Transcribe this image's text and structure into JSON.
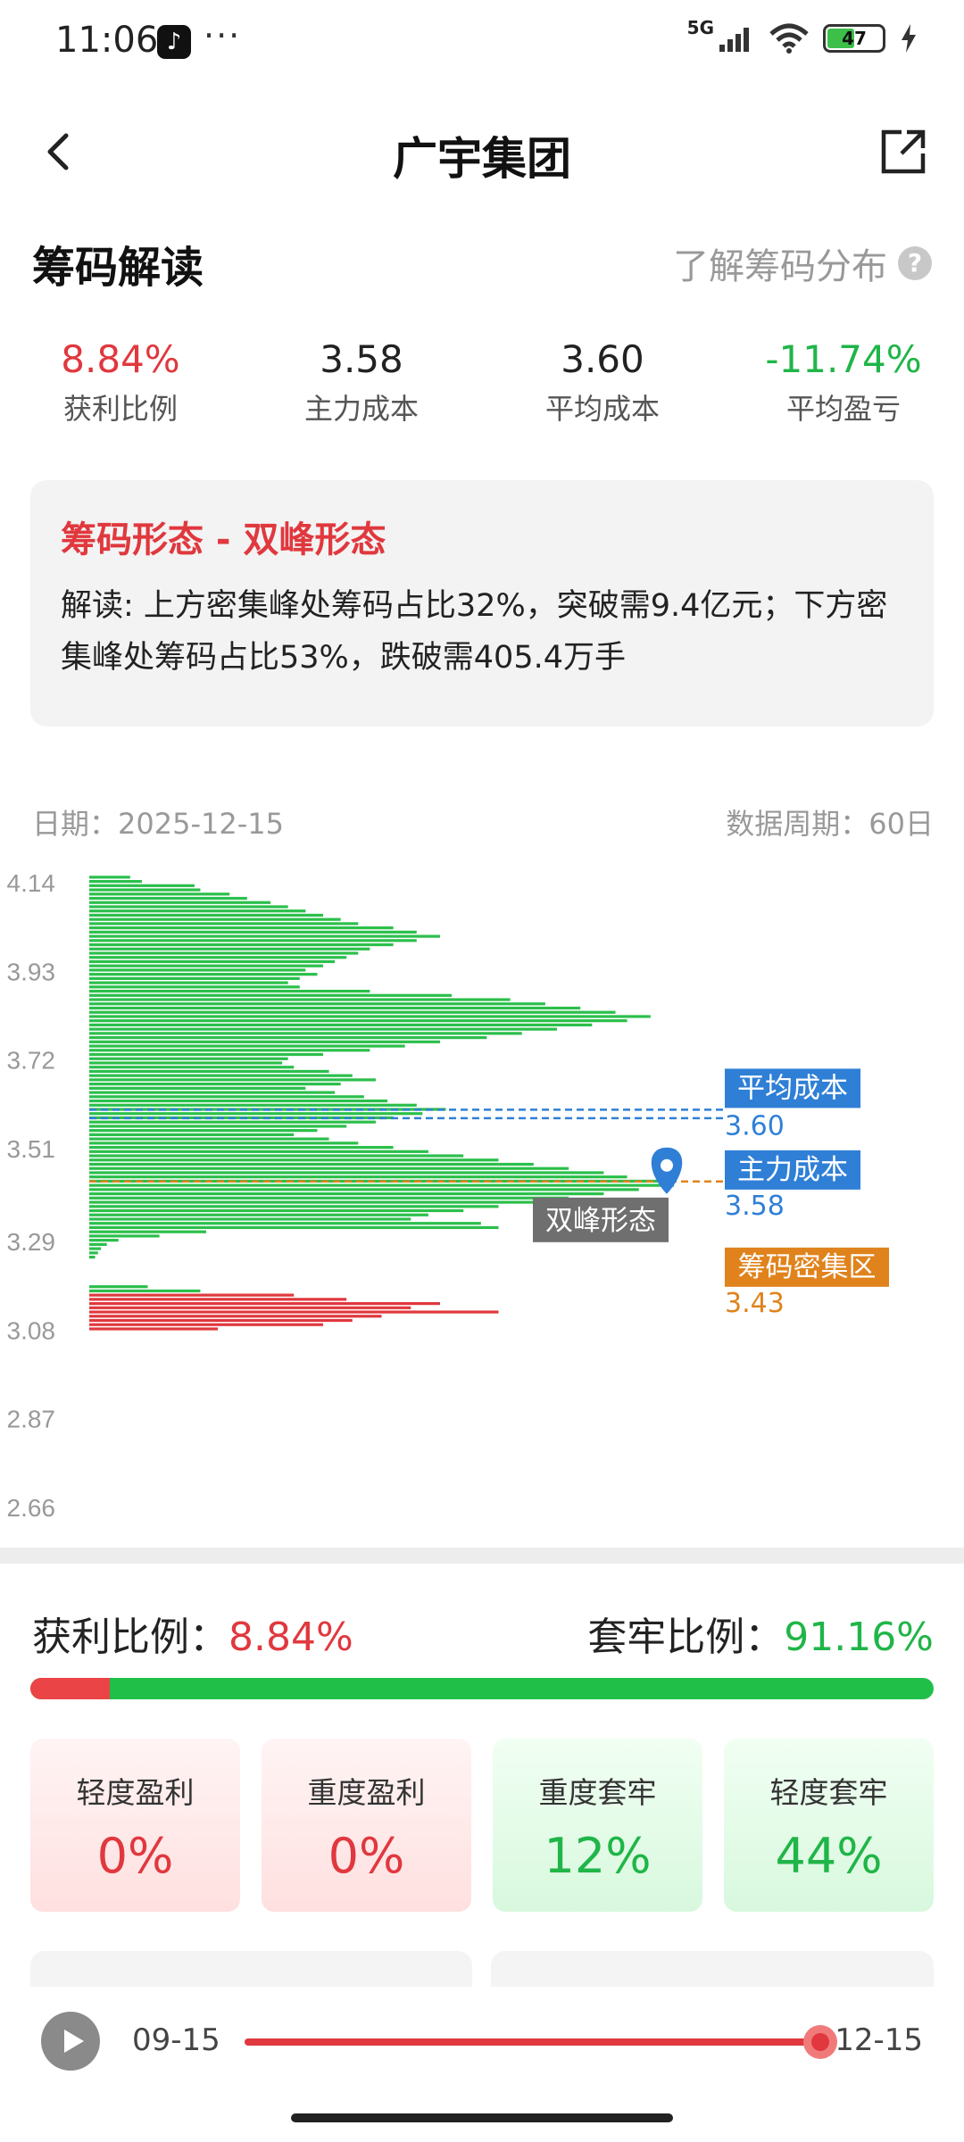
{
  "status_bar": {
    "time": "11:06",
    "app_badge": "♪",
    "dots": "···",
    "network": "5G",
    "battery": "47"
  },
  "header": {
    "title": "广宇集团"
  },
  "section": {
    "title": "筹码解读",
    "learn_link": "了解筹码分布",
    "help": "?"
  },
  "stats": [
    {
      "value": "8.84%",
      "label": "获利比例",
      "tone": "red"
    },
    {
      "value": "3.58",
      "label": "主力成本",
      "tone": "normal"
    },
    {
      "value": "3.60",
      "label": "平均成本",
      "tone": "normal"
    },
    {
      "value": "-11.74%",
      "label": "平均盈亏",
      "tone": "green"
    }
  ],
  "form_card": {
    "title": "筹码形态 - 双峰形态",
    "description": "解读: 上方密集峰处筹码占比32%，突破需9.4亿元；下方密集峰处筹码占比53%，跌破需405.4万手"
  },
  "chart_meta": {
    "date": "日期：2025-12-15",
    "period": "数据周期：60日"
  },
  "chart_data": {
    "type": "bar",
    "orientation": "horizontal",
    "y_ticks": [
      "4.14",
      "3.93",
      "3.72",
      "3.51",
      "3.29",
      "3.08",
      "2.87",
      "2.66"
    ],
    "ylim": [
      2.66,
      4.14
    ],
    "series": [
      {
        "name": "获利",
        "color": "#e0383e"
      },
      {
        "name": "套牢",
        "color": "#2bbf4b"
      }
    ],
    "bars": [
      [
        4.15,
        0.07,
        "g"
      ],
      [
        4.14,
        0.09,
        "g"
      ],
      [
        4.13,
        0.18,
        "g"
      ],
      [
        4.12,
        0.19,
        "g"
      ],
      [
        4.11,
        0.24,
        "g"
      ],
      [
        4.1,
        0.27,
        "g"
      ],
      [
        4.09,
        0.31,
        "g"
      ],
      [
        4.08,
        0.34,
        "g"
      ],
      [
        4.07,
        0.37,
        "g"
      ],
      [
        4.06,
        0.4,
        "g"
      ],
      [
        4.05,
        0.43,
        "g"
      ],
      [
        4.04,
        0.46,
        "g"
      ],
      [
        4.03,
        0.52,
        "g"
      ],
      [
        4.02,
        0.56,
        "g"
      ],
      [
        4.01,
        0.6,
        "g"
      ],
      [
        4.0,
        0.56,
        "g"
      ],
      [
        3.99,
        0.52,
        "g"
      ],
      [
        3.98,
        0.48,
        "g"
      ],
      [
        3.97,
        0.46,
        "g"
      ],
      [
        3.96,
        0.44,
        "g"
      ],
      [
        3.95,
        0.42,
        "g"
      ],
      [
        3.94,
        0.4,
        "g"
      ],
      [
        3.93,
        0.37,
        "g"
      ],
      [
        3.92,
        0.39,
        "g"
      ],
      [
        3.91,
        0.36,
        "g"
      ],
      [
        3.9,
        0.34,
        "g"
      ],
      [
        3.89,
        0.36,
        "g"
      ],
      [
        3.88,
        0.48,
        "g"
      ],
      [
        3.87,
        0.62,
        "g"
      ],
      [
        3.86,
        0.72,
        "g"
      ],
      [
        3.85,
        0.78,
        "g"
      ],
      [
        3.84,
        0.84,
        "g"
      ],
      [
        3.83,
        0.9,
        "g"
      ],
      [
        3.82,
        0.96,
        "g"
      ],
      [
        3.81,
        0.92,
        "g"
      ],
      [
        3.8,
        0.86,
        "g"
      ],
      [
        3.79,
        0.8,
        "g"
      ],
      [
        3.78,
        0.74,
        "g"
      ],
      [
        3.77,
        0.68,
        "g"
      ],
      [
        3.76,
        0.6,
        "g"
      ],
      [
        3.75,
        0.54,
        "g"
      ],
      [
        3.74,
        0.48,
        "g"
      ],
      [
        3.73,
        0.4,
        "g"
      ],
      [
        3.72,
        0.34,
        "g"
      ],
      [
        3.71,
        0.33,
        "g"
      ],
      [
        3.7,
        0.35,
        "g"
      ],
      [
        3.69,
        0.41,
        "g"
      ],
      [
        3.68,
        0.45,
        "g"
      ],
      [
        3.67,
        0.49,
        "g"
      ],
      [
        3.66,
        0.43,
        "g"
      ],
      [
        3.65,
        0.37,
        "g"
      ],
      [
        3.64,
        0.42,
        "g"
      ],
      [
        3.63,
        0.47,
        "g"
      ],
      [
        3.62,
        0.51,
        "g"
      ],
      [
        3.61,
        0.56,
        "g"
      ],
      [
        3.6,
        0.61,
        "g"
      ],
      [
        3.59,
        0.57,
        "g"
      ],
      [
        3.58,
        0.52,
        "g"
      ],
      [
        3.57,
        0.49,
        "g"
      ],
      [
        3.56,
        0.44,
        "g"
      ],
      [
        3.55,
        0.39,
        "g"
      ],
      [
        3.54,
        0.35,
        "g"
      ],
      [
        3.53,
        0.41,
        "g"
      ],
      [
        3.52,
        0.46,
        "g"
      ],
      [
        3.51,
        0.52,
        "g"
      ],
      [
        3.5,
        0.58,
        "g"
      ],
      [
        3.49,
        0.64,
        "g"
      ],
      [
        3.48,
        0.7,
        "g"
      ],
      [
        3.47,
        0.76,
        "g"
      ],
      [
        3.46,
        0.82,
        "g"
      ],
      [
        3.45,
        0.88,
        "g"
      ],
      [
        3.44,
        0.92,
        "g"
      ],
      [
        3.43,
        0.98,
        "g"
      ],
      [
        3.42,
        1.0,
        "g"
      ],
      [
        3.41,
        0.94,
        "g"
      ],
      [
        3.4,
        0.88,
        "g"
      ],
      [
        3.39,
        0.82,
        "g"
      ],
      [
        3.38,
        0.76,
        "g"
      ],
      [
        3.37,
        0.7,
        "g"
      ],
      [
        3.36,
        0.64,
        "g"
      ],
      [
        3.35,
        0.58,
        "g"
      ],
      [
        3.34,
        0.55,
        "g"
      ],
      [
        3.33,
        0.67,
        "g"
      ],
      [
        3.32,
        0.7,
        "g"
      ],
      [
        3.31,
        0.2,
        "g"
      ],
      [
        3.3,
        0.12,
        "g"
      ],
      [
        3.29,
        0.05,
        "g"
      ],
      [
        3.28,
        0.03,
        "g"
      ],
      [
        3.27,
        0.02,
        "g"
      ],
      [
        3.26,
        0.015,
        "g"
      ],
      [
        3.25,
        0.01,
        "g"
      ],
      [
        3.18,
        0.1,
        "g"
      ],
      [
        3.17,
        0.19,
        "g"
      ],
      [
        3.16,
        0.35,
        "r"
      ],
      [
        3.15,
        0.44,
        "r"
      ],
      [
        3.14,
        0.6,
        "r"
      ],
      [
        3.13,
        0.55,
        "r"
      ],
      [
        3.12,
        0.7,
        "r"
      ],
      [
        3.11,
        0.5,
        "r"
      ],
      [
        3.1,
        0.45,
        "r"
      ],
      [
        3.09,
        0.4,
        "r"
      ],
      [
        3.08,
        0.22,
        "r"
      ]
    ],
    "avg_cost": 3.6,
    "main_cost": 3.58,
    "dense_zone": 3.43,
    "labels": {
      "avg_cost": "平均成本",
      "avg_cost_value": "3.60",
      "main_cost": "主力成本",
      "main_cost_value": "3.58",
      "dense": "筹码密集区",
      "dense_value": "3.43",
      "pattern": "双峰形态"
    }
  },
  "ratio": {
    "profit_label": "获利比例：",
    "profit_value": "8.84%",
    "trapped_label": "套牢比例：",
    "trapped_value": "91.16%",
    "profit_fraction": 0.0884
  },
  "tiles": [
    {
      "label": "轻度盈利",
      "value": "0%",
      "kind": "pos"
    },
    {
      "label": "重度盈利",
      "value": "0%",
      "kind": "pos"
    },
    {
      "label": "重度套牢",
      "value": "12%",
      "kind": "neg"
    },
    {
      "label": "轻度套牢",
      "value": "44%",
      "kind": "neg"
    }
  ],
  "player": {
    "start": "09-15",
    "end": "12-15",
    "progress": 1.0
  },
  "colors": {
    "red": "#e0383e",
    "green": "#2bbf4b",
    "blue": "#2f7fd6",
    "orange": "#e0831c"
  }
}
